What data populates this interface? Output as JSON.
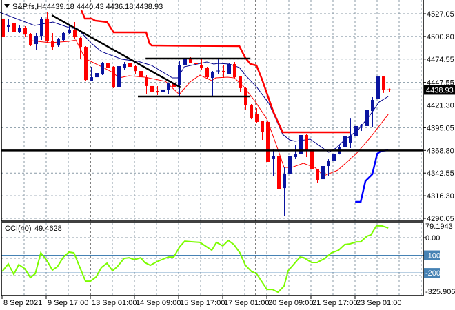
{
  "header": {
    "symbol_timeframe": "S&P.fs,H4",
    "ohlc": "4439.18 4440.43 4436.18 4438.93"
  },
  "chart_data": [
    {
      "type": "candlestick",
      "title": "S&P.fs,H4",
      "ylim": [
        4290.05,
        4527.05
      ],
      "price_ticks": [
        "4527.05",
        "4500.80",
        "4474.55",
        "4447.55",
        "4421.30",
        "4395.05",
        "4368.80",
        "4342.55",
        "4316.30",
        "4290.05"
      ],
      "current_price": "4438.93",
      "x_labels": [
        "8 Sep 2021",
        "9 Sep 17:00",
        "13 Sep 01:00",
        "14 Sep 09:00",
        "15 Sep 17:00",
        "17 Sep 01:00",
        "20 Sep 09:00",
        "21 Sep 17:00",
        "23 Sep 01:00"
      ],
      "candles_ohlc": [
        [
          4521.5,
          4521.5,
          4499.1,
          4500.7
        ],
        [
          4511.9,
          4520.7,
          4505.5,
          4514.3
        ],
        [
          4515.9,
          4519.9,
          4491.1,
          4505.5
        ],
        [
          4505.5,
          4514.3,
          4504.7,
          4511.1
        ],
        [
          4510.3,
          4512.7,
          4500.7,
          4503.9
        ],
        [
          4503.9,
          4504.7,
          4489.5,
          4491.1
        ],
        [
          4491.9,
          4504.7,
          4485.5,
          4501.5
        ],
        [
          4501.5,
          4523.1,
          4496.7,
          4520.7
        ],
        [
          4521.5,
          4528.6,
          4493.5,
          4495.1
        ],
        [
          4495.1,
          4504.7,
          4485.5,
          4488.7
        ],
        [
          4490.3,
          4499.1,
          4488.7,
          4497.5
        ],
        [
          4496.7,
          4506.3,
          4495.9,
          4504.7
        ],
        [
          4504.7,
          4513.5,
          4503.1,
          4508.7
        ],
        [
          4508.7,
          4517.5,
          4497.5,
          4499.9
        ],
        [
          4499.1,
          4500.7,
          4475.2,
          4488.7
        ],
        [
          4488.7,
          4489.5,
          4449.6,
          4450.4
        ],
        [
          4449.6,
          4465.6,
          4448.8,
          4453.6
        ],
        [
          4453.6,
          4460.8,
          4445.6,
          4458.4
        ],
        [
          4456.8,
          4471.2,
          4456.0,
          4469.6
        ],
        [
          4469.6,
          4482.4,
          4456.8,
          4464.8
        ],
        [
          4465.6,
          4466.4,
          4440.9,
          4441.7
        ],
        [
          4441.7,
          4467.2,
          4433.7,
          4466.4
        ],
        [
          4464.8,
          4471.2,
          4461.6,
          4468.8
        ],
        [
          4469.6,
          4470.4,
          4464.8,
          4465.6
        ],
        [
          4466.4,
          4467.2,
          4456.8,
          4460.8
        ],
        [
          4460.8,
          4479.2,
          4451.2,
          4453.6
        ],
        [
          4453.6,
          4456.0,
          4433.7,
          4443.3
        ],
        [
          4443.3,
          4444.8,
          4424.9,
          4436.9
        ],
        [
          4437.7,
          4443.3,
          4432.9,
          4436.1
        ],
        [
          4436.1,
          4445.6,
          4431.3,
          4438.5
        ],
        [
          4438.5,
          4447.2,
          4434.5,
          4446.4
        ],
        [
          4447.2,
          4448.8,
          4427.3,
          4442.5
        ],
        [
          4444.0,
          4472.8,
          4431.3,
          4467.2
        ],
        [
          4467.2,
          4476.8,
          4464.8,
          4476.0
        ],
        [
          4476.0,
          4476.8,
          4469.6,
          4469.6
        ],
        [
          4470.4,
          4472.8,
          4465.6,
          4468.8
        ],
        [
          4468.0,
          4475.2,
          4462.4,
          4464.0
        ],
        [
          4464.8,
          4465.6,
          4452.0,
          4453.6
        ],
        [
          4452.8,
          4460.8,
          4432.1,
          4460.0
        ],
        [
          4460.0,
          4475.2,
          4457.6,
          4460.8
        ],
        [
          4460.8,
          4467.2,
          4452.8,
          4459.2
        ],
        [
          4457.6,
          4469.6,
          4457.6,
          4468.8
        ],
        [
          4468.8,
          4471.2,
          4452.8,
          4453.6
        ],
        [
          4454.4,
          4455.2,
          4436.1,
          4440.9
        ],
        [
          4440.9,
          4441.7,
          4415.3,
          4420.9
        ],
        [
          4420.9,
          4422.5,
          4404.9,
          4406.5
        ],
        [
          4411.3,
          4417.7,
          4401.0,
          4401.8
        ],
        [
          4402.6,
          4402.6,
          4381.0,
          4390.6
        ],
        [
          4401.8,
          4401.8,
          4355.5,
          4355.5
        ],
        [
          4358.7,
          4369.8,
          4338.7,
          4362.6
        ],
        [
          4362.6,
          4365.0,
          4311.6,
          4324.3
        ],
        [
          4325.1,
          4349.1,
          4293.2,
          4341.9
        ],
        [
          4341.9,
          4365.0,
          4341.1,
          4361.9
        ],
        [
          4361.1,
          4374.6,
          4358.7,
          4365.0
        ],
        [
          4365.0,
          4395.4,
          4364.2,
          4386.6
        ],
        [
          4386.6,
          4387.4,
          4361.1,
          4369.0
        ],
        [
          4369.8,
          4369.8,
          4334.7,
          4346.7
        ],
        [
          4347.5,
          4347.5,
          4330.7,
          4334.7
        ],
        [
          4335.5,
          4360.3,
          4321.2,
          4350.7
        ],
        [
          4350.7,
          4358.7,
          4338.7,
          4357.1
        ],
        [
          4357.1,
          4371.4,
          4354.7,
          4365.0
        ],
        [
          4365.0,
          4375.4,
          4364.2,
          4373.0
        ],
        [
          4373.0,
          4401.8,
          4370.6,
          4385.8
        ],
        [
          4377.8,
          4405.7,
          4371.4,
          4385.8
        ],
        [
          4385.8,
          4398.6,
          4385.0,
          4397.0
        ],
        [
          4396.2,
          4399.4,
          4391.4,
          4397.0
        ],
        [
          4397.0,
          4424.1,
          4393.8,
          4416.1
        ],
        [
          4414.5,
          4430.5,
          4395.4,
          4427.3
        ],
        [
          4428.1,
          4455.2,
          4427.3,
          4454.4
        ],
        [
          4454.4,
          4454.4,
          4435.4,
          4439.3
        ],
        [
          4439.18,
          4440.43,
          4436.18,
          4438.93
        ]
      ],
      "overlays": [
        {
          "name": "fast-ma",
          "color": "#00008b",
          "width": 1,
          "points": [
            [
              -0.5,
              4528.6
            ],
            [
              5.75,
              4513.5
            ],
            [
              9.1,
              4517.5
            ],
            [
              12,
              4511.1
            ],
            [
              13.6,
              4509.5
            ],
            [
              16.1,
              4492.7
            ],
            [
              17.9,
              4483.2
            ],
            [
              21.6,
              4474.4
            ],
            [
              24.5,
              4472.0
            ],
            [
              27,
              4467.2
            ],
            [
              30.75,
              4452.8
            ],
            [
              31.75,
              4452.8
            ],
            [
              32.9,
              4465.6
            ],
            [
              37,
              4471.2
            ],
            [
              38.25,
              4468.8
            ],
            [
              39.1,
              4469.6
            ],
            [
              41.1,
              4468.8
            ],
            [
              42.9,
              4464.8
            ],
            [
              44.1,
              4455.2
            ],
            [
              46.1,
              4441.7
            ],
            [
              48.25,
              4423.3
            ],
            [
              50.75,
              4387.4
            ],
            [
              52,
              4381.0
            ],
            [
              53,
              4379.4
            ],
            [
              55.75,
              4381.8
            ],
            [
              59.1,
              4366.6
            ],
            [
              60.4,
              4371.4
            ],
            [
              61.6,
              4378.6
            ],
            [
              64.5,
              4393.0
            ],
            [
              66.6,
              4409.7
            ],
            [
              68.25,
              4424.9
            ],
            [
              69.9,
              4431.3
            ]
          ]
        },
        {
          "name": "slow-ma",
          "color": "#ff0000",
          "width": 1,
          "points": [
            [
              5,
              4496.0
            ],
            [
              8.6,
              4493.5
            ],
            [
              12,
              4495.1
            ],
            [
              13.25,
              4496.7
            ],
            [
              14.5,
              4480.8
            ],
            [
              15.4,
              4473.6
            ],
            [
              18.25,
              4464.8
            ],
            [
              19.9,
              4459.2
            ],
            [
              21.1,
              4452.8
            ],
            [
              22.9,
              4455.2
            ],
            [
              25.75,
              4453.6
            ],
            [
              29.5,
              4448.8
            ],
            [
              32,
              4433.7
            ],
            [
              34.1,
              4448.8
            ],
            [
              35.75,
              4456.0
            ],
            [
              37.9,
              4449.6
            ],
            [
              38.6,
              4452.8
            ],
            [
              40.75,
              4453.6
            ],
            [
              42,
              4452.8
            ],
            [
              43.6,
              4443.3
            ],
            [
              45.75,
              4425.7
            ],
            [
              47.9,
              4404.9
            ],
            [
              49.9,
              4369.8
            ],
            [
              51,
              4349.1
            ],
            [
              52.4,
              4349.1
            ],
            [
              54.5,
              4353.9
            ],
            [
              56.6,
              4349.1
            ],
            [
              58.25,
              4339.5
            ],
            [
              60.75,
              4345.9
            ],
            [
              64.1,
              4365.0
            ],
            [
              66.6,
              4383.4
            ],
            [
              68.25,
              4397.0
            ],
            [
              69.9,
              4410.5
            ]
          ]
        },
        {
          "name": "upper-channel",
          "color": "#ff0000",
          "width": 2.5,
          "points": [
            [
              14.25,
              4531
            ],
            [
              14.9,
              4521.5
            ],
            [
              16.1,
              4521.5
            ],
            [
              16.75,
              4519.1
            ],
            [
              18.9,
              4517.5
            ],
            [
              20.1,
              4505.5
            ],
            [
              26,
              4505.5
            ],
            [
              26.6,
              4492.7
            ],
            [
              27,
              4490.3
            ],
            [
              42.9,
              4489.5
            ],
            [
              43.9,
              4476.8
            ],
            [
              44.9,
              4468.8
            ],
            [
              46,
              4467.2
            ],
            [
              47,
              4451.2
            ],
            [
              49.1,
              4412.9
            ],
            [
              50.75,
              4389.8
            ],
            [
              62.9,
              4389.8
            ]
          ]
        },
        {
          "name": "lower-channel",
          "color": "#0000ff",
          "width": 2.5,
          "points": [
            [
              63.9,
              4309.2
            ],
            [
              64.9,
              4309.2
            ],
            [
              65.75,
              4333.1
            ],
            [
              67,
              4341.1
            ],
            [
              67.9,
              4365.0
            ],
            [
              68.6,
              4368.2
            ],
            [
              69.9,
              4369.0
            ]
          ]
        },
        {
          "name": "trendline",
          "color": "#000000",
          "width": 2.5,
          "points": [
            [
              8.9,
              4525.4
            ],
            [
              32.25,
              4441.7
            ]
          ]
        },
        {
          "name": "range-top",
          "color": "#000000",
          "width": 2.5,
          "points": [
            [
              25.9,
              4475.2
            ],
            [
              44.9,
              4475.2
            ]
          ]
        },
        {
          "name": "range-bottom",
          "color": "#000000",
          "width": 2.5,
          "points": [
            [
              24.5,
              4431.3
            ],
            [
              44.9,
              4431.3
            ]
          ]
        }
      ],
      "support_level": 4368.8
    },
    {
      "type": "line",
      "title": "CCI(40)",
      "value_label": "49.4628",
      "ylim": [
        -325.9062,
        79.1943
      ],
      "tick_labels": [
        "79.1943",
        "0.00",
        "-100",
        "-200",
        "-325.9062"
      ],
      "levels": [
        -100,
        -200
      ],
      "series_color": "#7cfc00",
      "points": [
        [
          -0.1,
          -192
        ],
        [
          1,
          -149
        ],
        [
          2,
          -208
        ],
        [
          2.9,
          -153
        ],
        [
          4,
          -176
        ],
        [
          5,
          -227
        ],
        [
          5.9,
          -204
        ],
        [
          6.9,
          -86
        ],
        [
          7.9,
          -125
        ],
        [
          9,
          -184
        ],
        [
          9.9,
          -165
        ],
        [
          11,
          -110
        ],
        [
          12,
          -82
        ],
        [
          12.9,
          -86
        ],
        [
          15,
          -247
        ],
        [
          15.9,
          -247
        ],
        [
          16.9,
          -224
        ],
        [
          17.9,
          -169
        ],
        [
          18.9,
          -145
        ],
        [
          19.9,
          -188
        ],
        [
          20.75,
          -165
        ],
        [
          22,
          -118
        ],
        [
          22.9,
          -114
        ],
        [
          23.9,
          -125
        ],
        [
          25,
          -114
        ],
        [
          25.75,
          -141
        ],
        [
          26.75,
          -157
        ],
        [
          27.9,
          -137
        ],
        [
          30,
          -110
        ],
        [
          31,
          -110
        ],
        [
          32.1,
          -51
        ],
        [
          33,
          -20
        ],
        [
          34.4,
          -24
        ],
        [
          35.75,
          -27
        ],
        [
          37.9,
          -71
        ],
        [
          38.75,
          -27
        ],
        [
          39.9,
          -47
        ],
        [
          40.9,
          -16
        ],
        [
          41.9,
          -39
        ],
        [
          43,
          -86
        ],
        [
          44,
          -157
        ],
        [
          45.1,
          -192
        ],
        [
          46,
          -204
        ],
        [
          47.9,
          -294
        ],
        [
          48.9,
          -294
        ],
        [
          49.9,
          -310
        ],
        [
          51,
          -275
        ],
        [
          51.75,
          -188
        ],
        [
          53.9,
          -110
        ],
        [
          54.6,
          -114
        ],
        [
          56,
          -141
        ],
        [
          57,
          -141
        ],
        [
          58.4,
          -118
        ],
        [
          59.6,
          -86
        ],
        [
          60.9,
          -71
        ],
        [
          62,
          -39
        ],
        [
          63,
          -35
        ],
        [
          64.1,
          -24
        ],
        [
          64.9,
          -24
        ],
        [
          66,
          8
        ],
        [
          66.75,
          16
        ],
        [
          67.75,
          67
        ],
        [
          68.75,
          67
        ],
        [
          69.9,
          55
        ]
      ]
    }
  ]
}
